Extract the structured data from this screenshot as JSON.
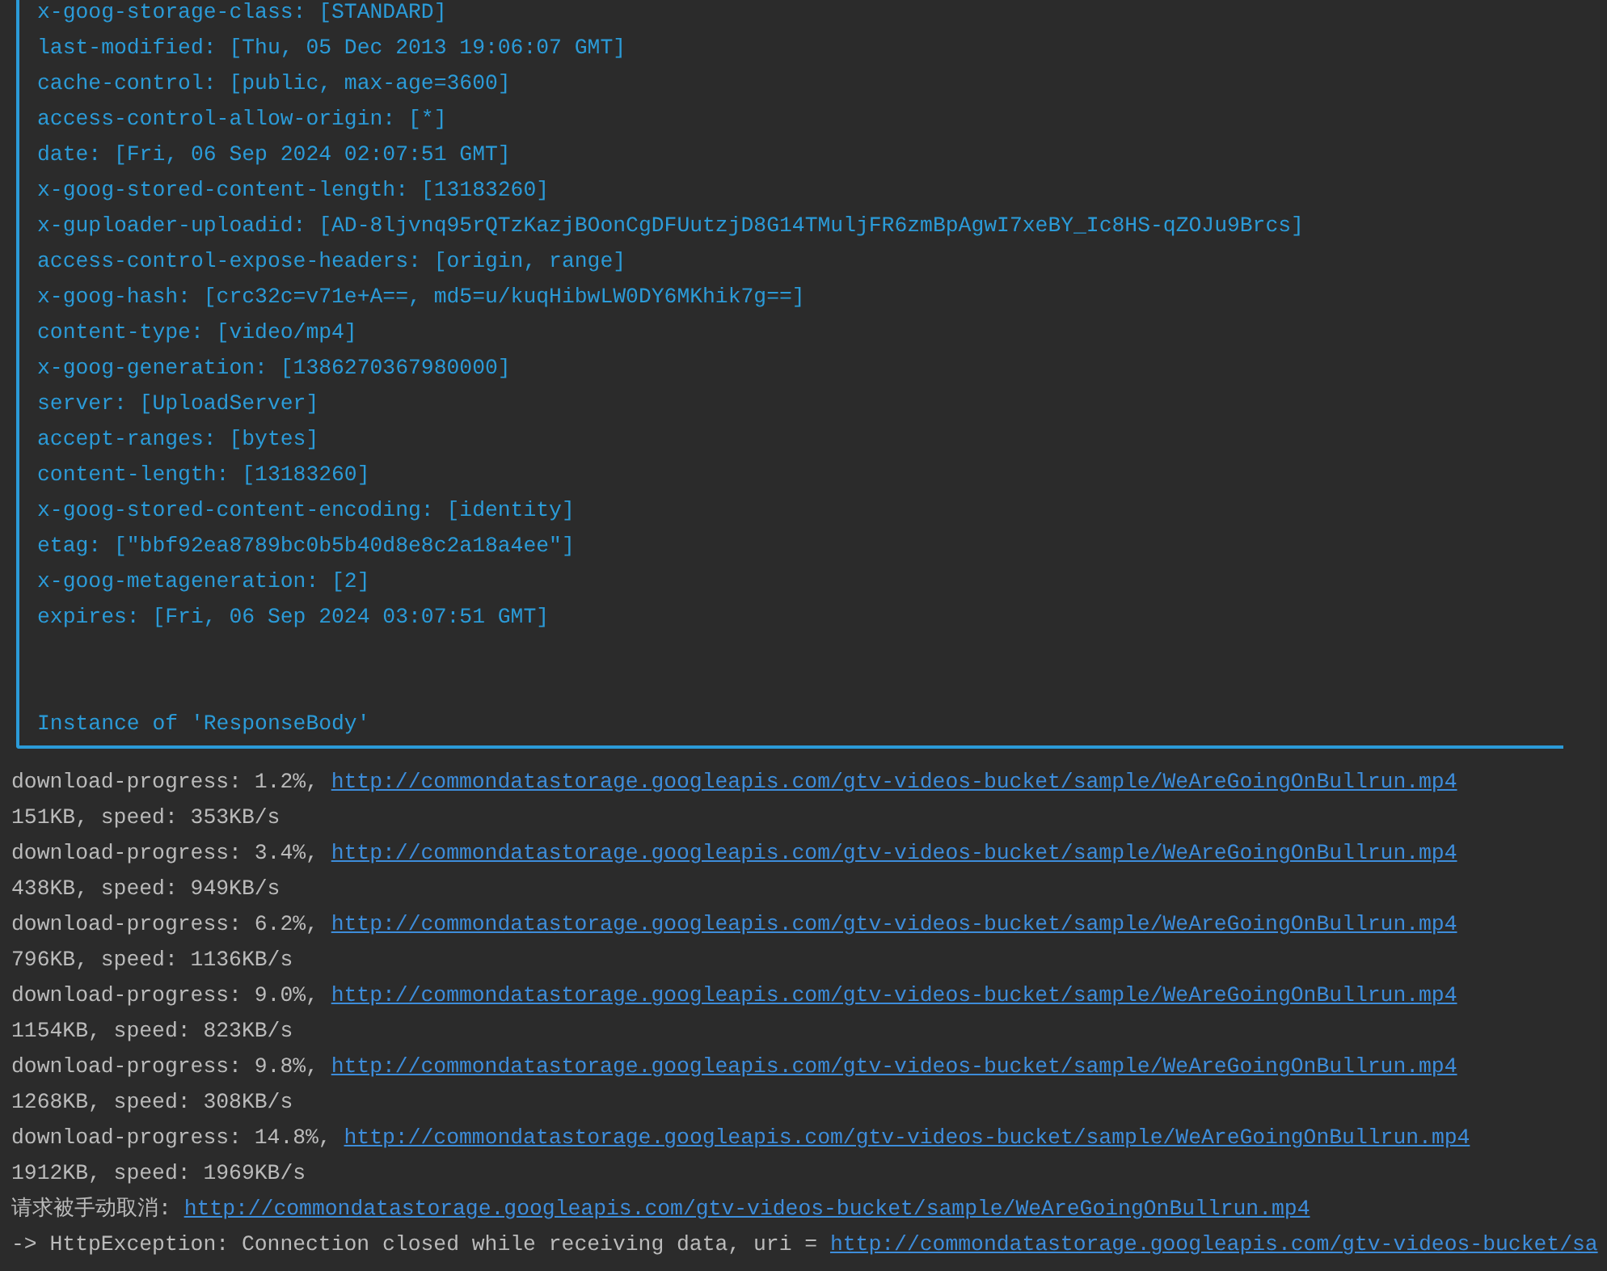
{
  "response_box": {
    "headers": [
      "x-goog-storage-class: [STANDARD]",
      "last-modified: [Thu, 05 Dec 2013 19:06:07 GMT]",
      "cache-control: [public, max-age=3600]",
      "access-control-allow-origin: [*]",
      "date: [Fri, 06 Sep 2024 02:07:51 GMT]",
      "x-goog-stored-content-length: [13183260]",
      "x-guploader-uploadid: [AD-8ljvnq95rQTzKazjBOonCgDFUutzjD8G14TMuljFR6zmBpAgwI7xeBY_Ic8HS-qZOJu9Brcs]",
      "access-control-expose-headers: [origin, range]",
      "x-goog-hash: [crc32c=v71e+A==, md5=u/kuqHibwLW0DY6MKhik7g==]",
      "content-type: [video/mp4]",
      "x-goog-generation: [1386270367980000]",
      "server: [UploadServer]",
      "accept-ranges: [bytes]",
      "content-length: [13183260]",
      "x-goog-stored-content-encoding: [identity]",
      "etag: [\"bbf92ea8789bc0b5b40d8e8c2a18a4ee\"]",
      "x-goog-metageneration: [2]",
      "expires: [Fri, 06 Sep 2024 03:07:51 GMT]"
    ],
    "instance_text": "Instance of 'ResponseBody'"
  },
  "log": [
    {
      "kind": "link",
      "text": "download-progress: 1.2%,",
      "link": "http://commondatastorage.googleapis.com/gtv-videos-bucket/sample/WeAreGoingOnBullrun.mp4"
    },
    {
      "kind": "plain",
      "text": "151KB, speed: 353KB/s"
    },
    {
      "kind": "link",
      "text": "download-progress: 3.4%,",
      "link": "http://commondatastorage.googleapis.com/gtv-videos-bucket/sample/WeAreGoingOnBullrun.mp4"
    },
    {
      "kind": "plain",
      "text": "438KB, speed: 949KB/s"
    },
    {
      "kind": "link",
      "text": "download-progress: 6.2%,",
      "link": "http://commondatastorage.googleapis.com/gtv-videos-bucket/sample/WeAreGoingOnBullrun.mp4"
    },
    {
      "kind": "plain",
      "text": "796KB, speed: 1136KB/s"
    },
    {
      "kind": "link",
      "text": "download-progress: 9.0%,",
      "link": "http://commondatastorage.googleapis.com/gtv-videos-bucket/sample/WeAreGoingOnBullrun.mp4"
    },
    {
      "kind": "plain",
      "text": "1154KB, speed: 823KB/s"
    },
    {
      "kind": "link",
      "text": "download-progress: 9.8%,",
      "link": "http://commondatastorage.googleapis.com/gtv-videos-bucket/sample/WeAreGoingOnBullrun.mp4"
    },
    {
      "kind": "plain",
      "text": "1268KB, speed: 308KB/s"
    },
    {
      "kind": "link",
      "text": "download-progress: 14.8%,",
      "link": "http://commondatastorage.googleapis.com/gtv-videos-bucket/sample/WeAreGoingOnBullrun.mp4"
    },
    {
      "kind": "plain",
      "text": "1912KB, speed: 1969KB/s"
    },
    {
      "kind": "link",
      "text": "请求被手动取消:",
      "link": "http://commondatastorage.googleapis.com/gtv-videos-bucket/sample/WeAreGoingOnBullrun.mp4"
    },
    {
      "kind": "link",
      "text": "-> HttpException: Connection closed while receiving data, uri =",
      "link": "http://commondatastorage.googleapis.com/gtv-videos-bucket/sa"
    }
  ]
}
